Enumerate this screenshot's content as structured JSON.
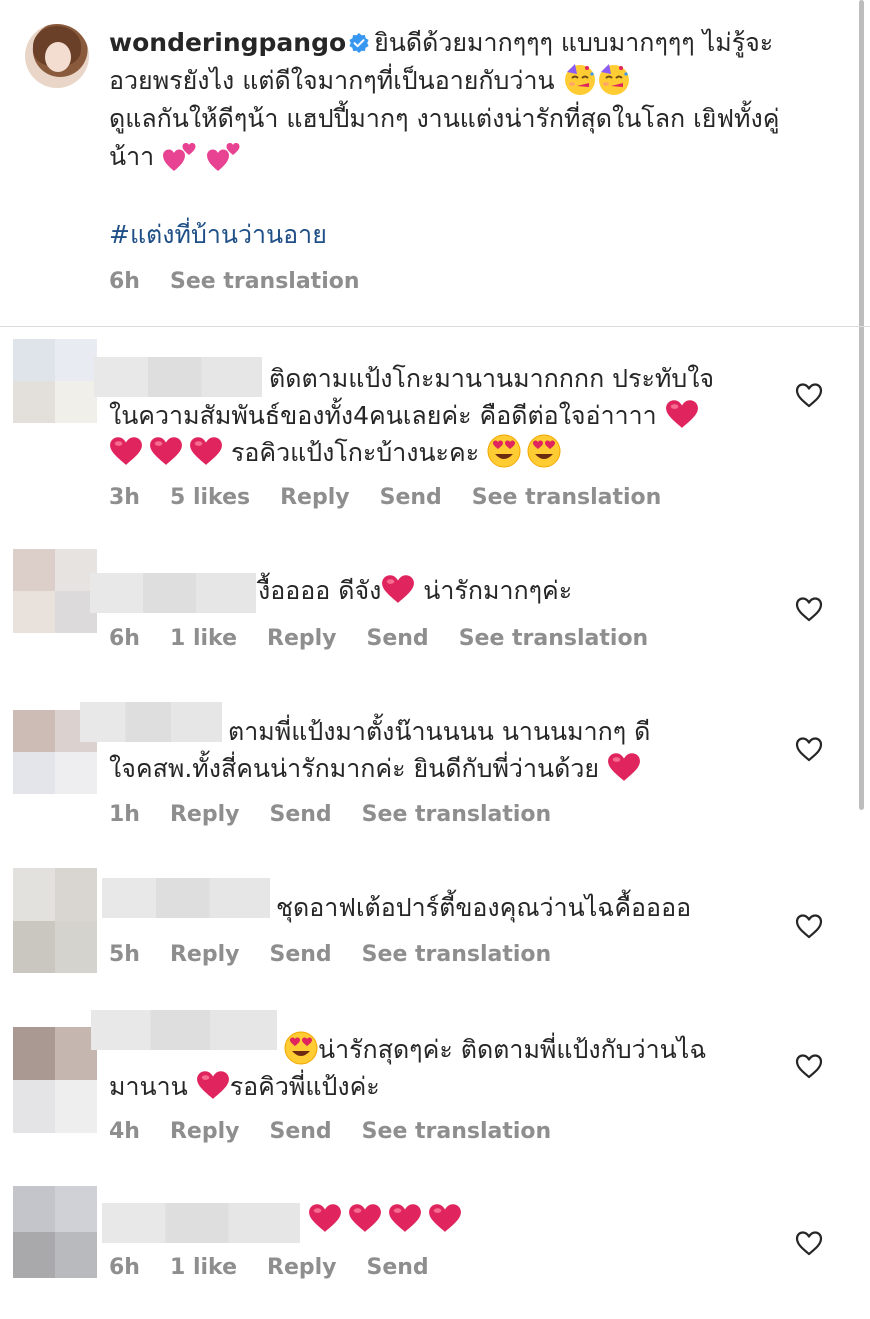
{
  "caption": {
    "username": "wonderingpango",
    "line1_text": "ยินดีด้วยมากๆๆๆ แบบมากๆๆๆ ไม่รู้จะ",
    "line2_text": "อวยพรยังไง แต่ดีใจมากๆที่เป็นอายกับว่าน",
    "line3_text": "ดูแลกันให้ดีๆน้า แฮปปี้มากๆ งานแต่งน่ารักที่สุดในโลก เยิฟทั้งคู่",
    "line4_text": "น้าา",
    "hashtag": "#แต่งที่บ้านว่านอาย",
    "time": "6h",
    "see_translation": "See translation",
    "emoji_icons": [
      "partying-face-icon",
      "partying-face-icon",
      "two-hearts-icon",
      "two-hearts-icon"
    ]
  },
  "colors": {
    "text": "#262626",
    "meta": "#8e8e8e",
    "hashtag": "#1f4f86",
    "verified": "#3897f0",
    "heart": "#e0245e",
    "divider": "#dbdbdb"
  },
  "comments": [
    {
      "line1": "ติดตามแป้งโกะมานานมากกกก ประทับใจ",
      "line2": "ในความสัมพันธ์ของทั้ง4คนเลยค่ะ คือดีต่อใจอ่าาาา",
      "line3": "รอคิวแป้งโกะบ้างนะคะ",
      "time": "3h",
      "likes": "5 likes",
      "reply": "Reply",
      "send": "Send",
      "see_translation": "See translation"
    },
    {
      "line1a": "งื้ออออ ดีจัง",
      "line1b": "น่ารักมากๆค่ะ",
      "time": "6h",
      "likes": "1 like",
      "reply": "Reply",
      "send": "Send",
      "see_translation": "See translation"
    },
    {
      "line1": "ตามพี่แป้งมาตั้งน๊านนนน นานนมากๆ ดี",
      "line2": "ใจคสพ.ทั้งสี่คนน่ารักมากค่ะ ยินดีกับพี่ว่านด้วย",
      "time": "1h",
      "reply": "Reply",
      "send": "Send",
      "see_translation": "See translation"
    },
    {
      "line1": "ชุดอาฟเต้อปาร์ตี้ของคุณว่านไฉคื้ออออ",
      "time": "5h",
      "reply": "Reply",
      "send": "Send",
      "see_translation": "See translation"
    },
    {
      "line1": "น่ารักสุดๆค่ะ ติดตามพี่แป้งกับว่านไฉ",
      "line2": "รอคิวพี่แป้งค่ะ",
      "line2_prefix": "มานาน",
      "time": "4h",
      "reply": "Reply",
      "send": "Send",
      "see_translation": "See translation"
    },
    {
      "time": "6h",
      "likes": "1 like",
      "reply": "Reply",
      "send": "Send"
    }
  ]
}
